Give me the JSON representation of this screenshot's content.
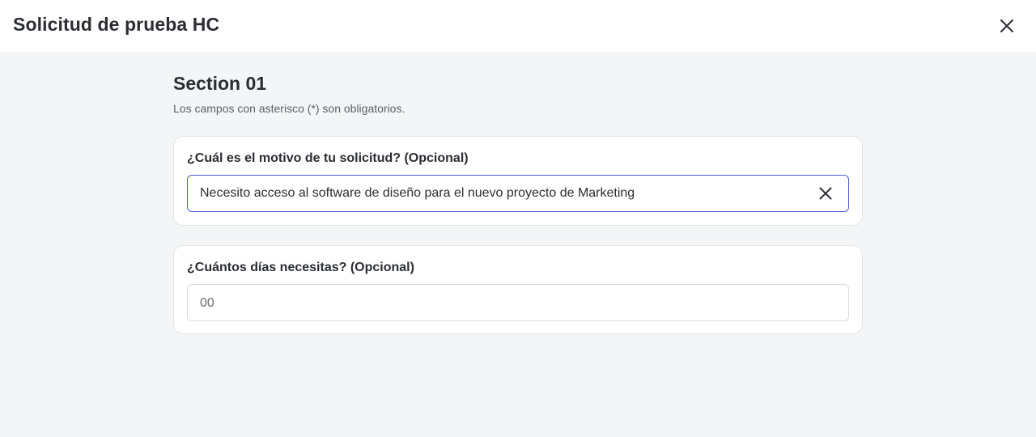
{
  "header": {
    "title": "Solicitud de prueba HC",
    "close_icon": "close-icon"
  },
  "section": {
    "title": "Section 01",
    "subtitle": "Los campos con asterisco (*) son obligatorios."
  },
  "questions": [
    {
      "label": "¿Cuál es el motivo de tu solicitud? (Opcional)",
      "value": "Necesito acceso al software de diseño para el nuevo proyecto de Marketing",
      "clear_icon": "close-icon"
    },
    {
      "label": "¿Cuántos días necesitas? (Opcional)",
      "placeholder": "00"
    }
  ],
  "colors": {
    "focus_border": "#4a5bd4",
    "background": "#f4f5f7"
  }
}
